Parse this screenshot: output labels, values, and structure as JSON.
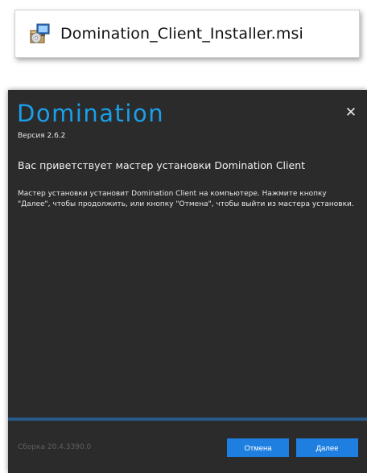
{
  "file": {
    "name": "Domination_Client_Installer.msi",
    "icon": "msi-installer-icon"
  },
  "installer": {
    "brand": "Domination",
    "version": "Версия 2.6.2",
    "close_icon": "close-icon",
    "welcome_title": "Вас приветствует мастер установки Domination Client",
    "welcome_body": "Мастер установки установит Domination Client на компьютере. Нажмите кнопку \"Далее\", чтобы продолжить, или кнопку \"Отмена\", чтобы выйти из мастера установки.",
    "build": "Сборка 20.4.3390.0",
    "cancel_label": "Отмена",
    "next_label": "Далее"
  },
  "colors": {
    "brand": "#1aa0ea",
    "background": "#2b2b2b",
    "button": "#1e7fe0",
    "footer_line": "#2a5a8a"
  }
}
